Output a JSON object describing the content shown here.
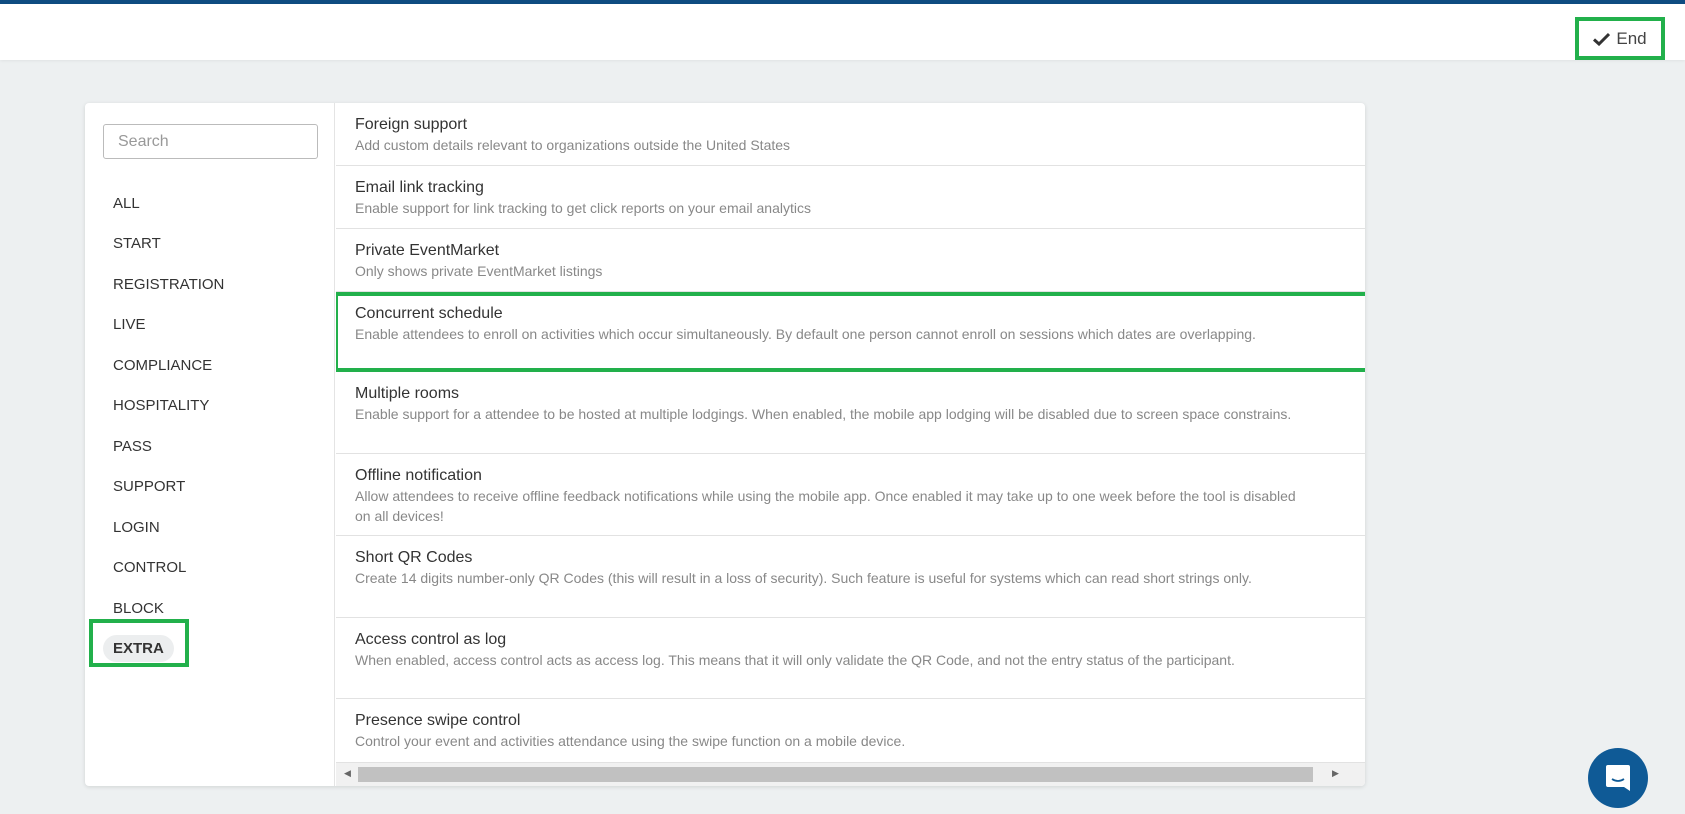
{
  "header": {
    "end_label": "End",
    "end_icon": "check-icon"
  },
  "colors": {
    "accent": "#0f4c81",
    "highlight": "#22b04b",
    "toggle_on": "#4cd964"
  },
  "sidebar": {
    "search_placeholder": "Search",
    "items": [
      {
        "label": "ALL"
      },
      {
        "label": "START"
      },
      {
        "label": "REGISTRATION"
      },
      {
        "label": "LIVE"
      },
      {
        "label": "COMPLIANCE"
      },
      {
        "label": "HOSPITALITY"
      },
      {
        "label": "PASS"
      },
      {
        "label": "SUPPORT"
      },
      {
        "label": "LOGIN"
      },
      {
        "label": "CONTROL"
      },
      {
        "label": "BLOCK"
      },
      {
        "label": "EXTRA",
        "active": true
      }
    ]
  },
  "features": [
    {
      "title": "Foreign support",
      "desc": "Add custom details relevant to organizations outside the United States",
      "on": true
    },
    {
      "title": "Email link tracking",
      "desc": "Enable support for link tracking to get click reports on your email analytics",
      "on": true
    },
    {
      "title": "Private EventMarket",
      "desc": "Only shows private EventMarket listings",
      "on": false
    },
    {
      "title": "Concurrent schedule",
      "desc": "Enable attendees to enroll on activities which occur simultaneously. By default one person cannot enroll on sessions which dates are overlapping.",
      "on": false,
      "highlighted": true
    },
    {
      "title": "Multiple rooms",
      "desc": "Enable support for a attendee to be hosted at multiple lodgings. When enabled, the mobile app lodging will be disabled due to screen space constrains.",
      "on": false
    },
    {
      "title": "Offline notification",
      "desc": "Allow attendees to receive offline feedback notifications while using the mobile app. Once enabled it may take up to one week before the tool is disabled on all devices!",
      "on": false
    },
    {
      "title": "Short QR Codes",
      "desc": "Create 14 digits number-only QR Codes (this will result in a loss of security). Such feature is useful for systems which can read short strings only.",
      "on": false
    },
    {
      "title": "Access control as log",
      "desc": "When enabled, access control acts as access log. This means that it will only validate the QR Code, and not the entry status of the participant.",
      "on": false
    },
    {
      "title": "Presence swipe control",
      "desc": "Control your event and activities attendance using the swipe function on a mobile device.",
      "on": true
    }
  ],
  "chat": {
    "icon": "chat-icon"
  }
}
